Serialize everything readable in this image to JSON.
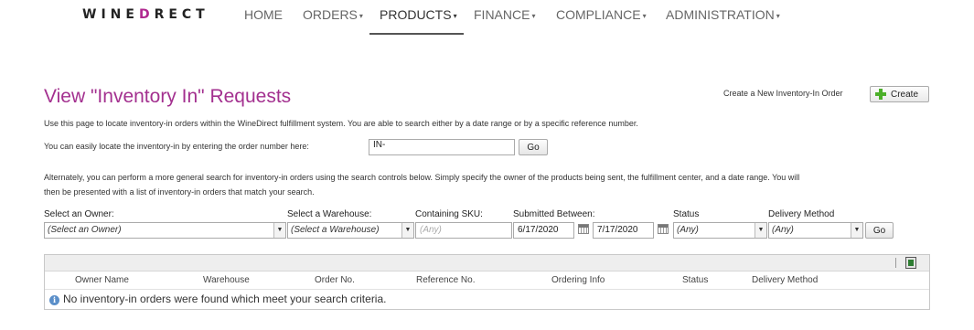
{
  "nav": {
    "logo_part1": "WINE",
    "logo_mark": "D",
    "logo_part2": "RECT",
    "items": [
      {
        "label": "HOME",
        "has_caret": false
      },
      {
        "label": "ORDERS",
        "has_caret": true
      },
      {
        "label": "PRODUCTS",
        "has_caret": true,
        "active": true
      },
      {
        "label": "FINANCE",
        "has_caret": true
      },
      {
        "label": "COMPLIANCE",
        "has_caret": true
      },
      {
        "label": "ADMINISTRATION",
        "has_caret": true
      }
    ],
    "caret_glyph": "▾"
  },
  "page": {
    "title": "View \"Inventory In\" Requests",
    "create_label": "Create a New Inventory-In Order",
    "create_button": "Create",
    "intro": "Use this page to locate inventory-in orders within the WineDirect fulfillment system. You are able to search either by a date range or by a specific reference number.",
    "ref_prompt": "You can easily locate the inventory-in by entering the order number here:",
    "ref_value": "IN-",
    "ref_go": "Go",
    "alt_text_line1": "Alternately, you can perform a more general search for inventory-in orders using the search controls below. Simply specify the owner of the products being sent, the fulfillment center, and a date range. You will",
    "alt_text_line2": "then be presented with a list of inventory-in orders that match your search."
  },
  "search": {
    "owner_label": "Select an Owner:",
    "owner_value": "(Select an Owner)",
    "warehouse_label": "Select a Warehouse:",
    "warehouse_value": "(Select a Warehouse)",
    "sku_label": "Containing SKU:",
    "sku_placeholder": "(Any)",
    "submitted_label": "Submitted Between:",
    "date_from": "6/17/2020",
    "date_to": "7/17/2020",
    "status_label": "Status",
    "status_value": "(Any)",
    "delivery_label": "Delivery Method",
    "delivery_value": "(Any)",
    "go": "Go",
    "arrow_glyph": "▼"
  },
  "grid": {
    "columns": [
      "Owner Name",
      "Warehouse",
      "Order No.",
      "Reference No.",
      "Ordering Info",
      "Status",
      "Delivery Method"
    ],
    "info_glyph": "i",
    "empty_message": "No inventory-in orders were found which meet your search criteria."
  },
  "colors": {
    "brand": "#a3308f",
    "create_icon": "#4caf2a",
    "info_icon": "#5b8fc9"
  }
}
